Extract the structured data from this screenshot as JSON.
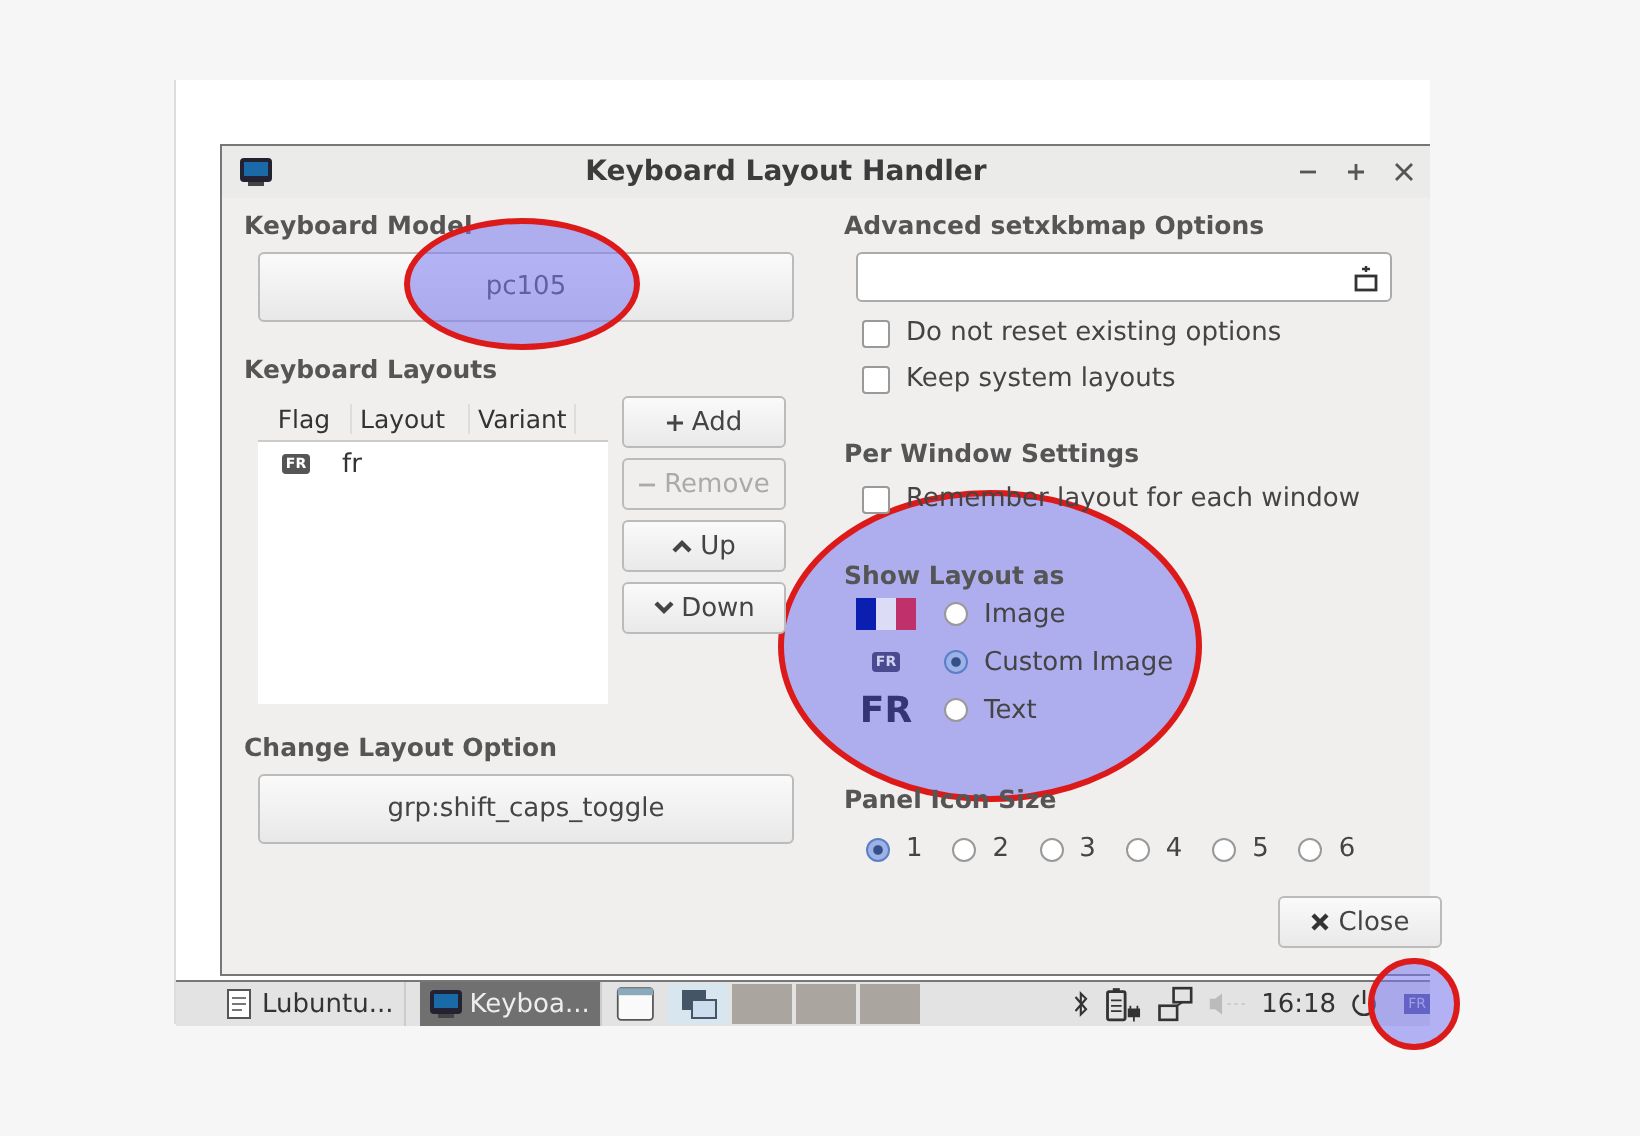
{
  "window": {
    "title": "Keyboard Layout Handler"
  },
  "keyboard_model": {
    "label": "Keyboard Model",
    "value": "pc105"
  },
  "keyboard_layouts": {
    "label": "Keyboard Layouts",
    "columns": [
      "Flag",
      "Layout",
      "Variant"
    ],
    "rows": [
      {
        "flag": "FR",
        "layout": "fr",
        "variant": "",
        "selected": false
      }
    ]
  },
  "layout_buttons": [
    {
      "kind": "add",
      "label": "Add",
      "disabled": false
    },
    {
      "kind": "remove",
      "label": "Remove",
      "disabled": true
    },
    {
      "kind": "up",
      "label": "Up",
      "disabled": false
    },
    {
      "kind": "down",
      "label": "Down",
      "disabled": false
    }
  ],
  "change_layout_option": {
    "label": "Change Layout Option",
    "value": "grp:shift_caps_toggle"
  },
  "advanced_options": {
    "label": "Advanced setxkbmap Options",
    "checkboxes": [
      {
        "label": "Do not reset existing options",
        "checked": false
      },
      {
        "label": "Keep system layouts",
        "checked": false
      }
    ]
  },
  "per_window": {
    "label": "Per Window Settings",
    "checkboxes": [
      {
        "label": "Remember layout for each window",
        "checked": false
      }
    ]
  },
  "show_layout_as": {
    "label": "Show Layout as",
    "options": [
      {
        "kind": "flag",
        "label": "Image",
        "selected": false
      },
      {
        "kind": "badge",
        "preview": "FR",
        "label": "Custom Image",
        "selected": true
      },
      {
        "kind": "text",
        "preview": "FR",
        "label": "Text",
        "selected": false
      }
    ]
  },
  "panel_icon_size": {
    "label": "Panel Icon Size",
    "options": [
      {
        "label": "1",
        "selected": true
      },
      {
        "label": "2",
        "selected": false
      },
      {
        "label": "3",
        "selected": false
      },
      {
        "label": "4",
        "selected": false
      },
      {
        "label": "5",
        "selected": false
      },
      {
        "label": "6",
        "selected": false
      }
    ]
  },
  "close_button": "Close",
  "taskbar": {
    "tasks": [
      {
        "label": "Lubuntu...",
        "kind": "editor",
        "selected": false
      },
      {
        "label": "Keyboa...",
        "kind": "window",
        "selected": true
      }
    ],
    "clock": "16:18",
    "keyboard_indicator": "FR"
  }
}
